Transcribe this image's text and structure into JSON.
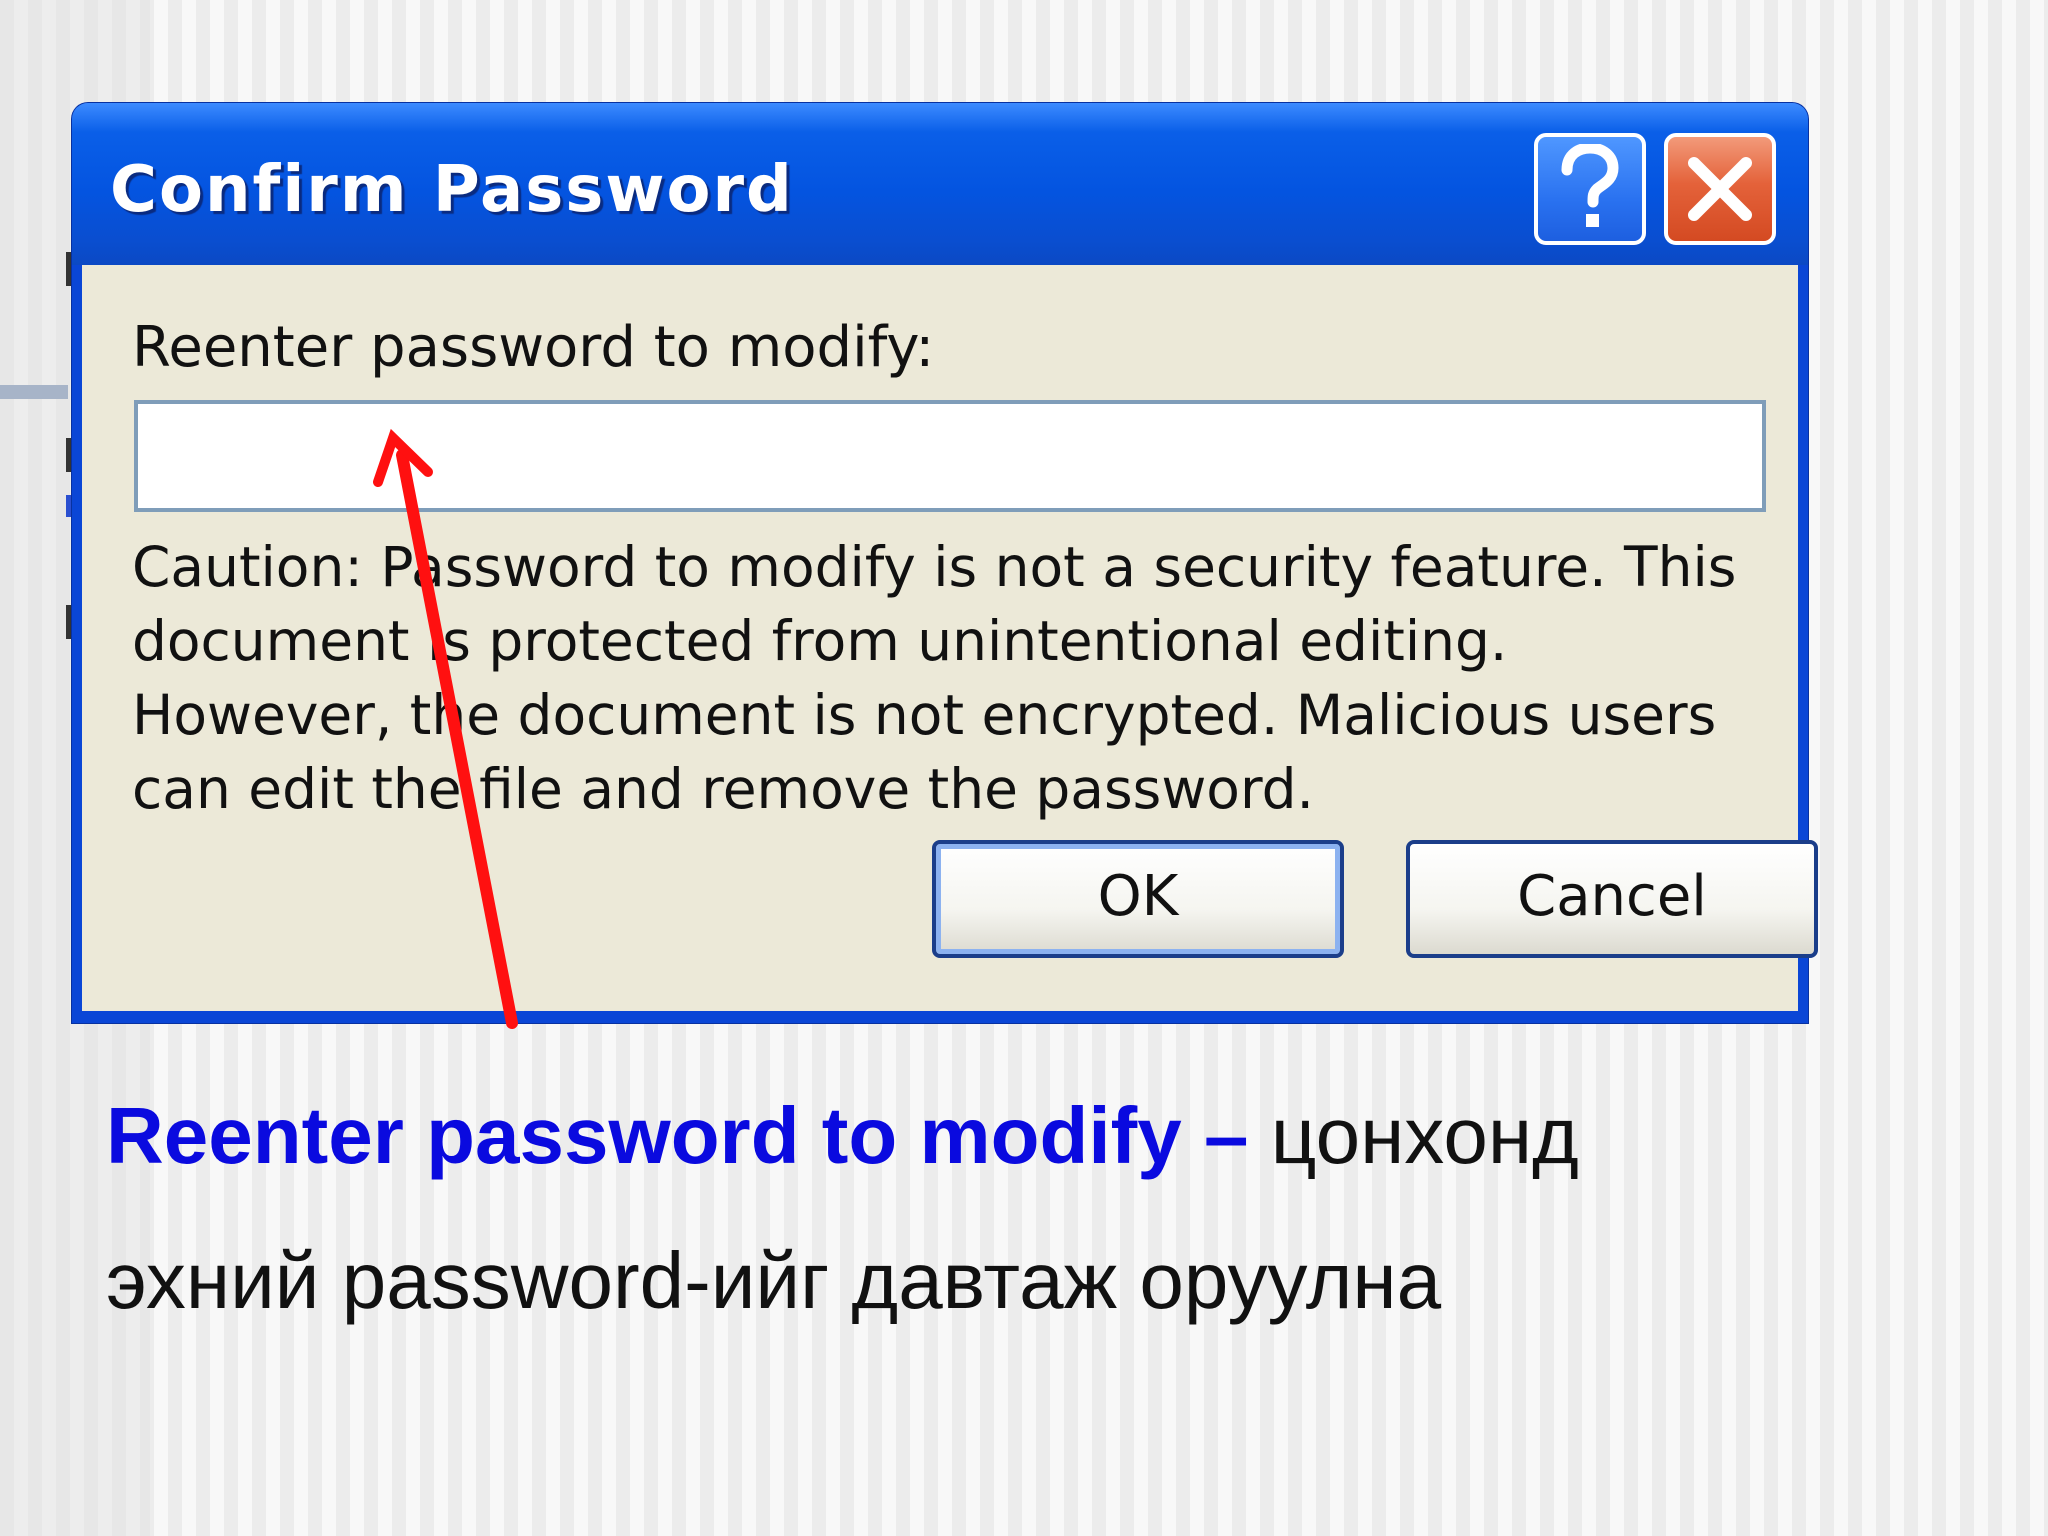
{
  "dialog": {
    "title": "Confirm Password",
    "help_icon": "question-mark-icon",
    "close_icon": "close-x-icon",
    "prompt_label": "Reenter password to modify:",
    "password_value": "",
    "caution_text": "Caution: Password to modify is not a security feature. This document is protected from unintentional editing. However, the document is not encrypted. Malicious users can edit the file and remove the password.",
    "ok_label": "OK",
    "cancel_label": "Cancel"
  },
  "annotation": {
    "arrow_icon": "red-arrow-icon",
    "arrow_color": "#ff1010"
  },
  "explanation": {
    "term": "Reenter password to modify",
    "dash": " –",
    "line1_rest": " цонхонд",
    "line2": "эхний password-ийг давтаж оруулна",
    "term_color": "#0a0adf"
  },
  "colors": {
    "titlebar_blue": "#0454e0",
    "client_bg": "#ece9d8",
    "close_red": "#e4623a"
  }
}
